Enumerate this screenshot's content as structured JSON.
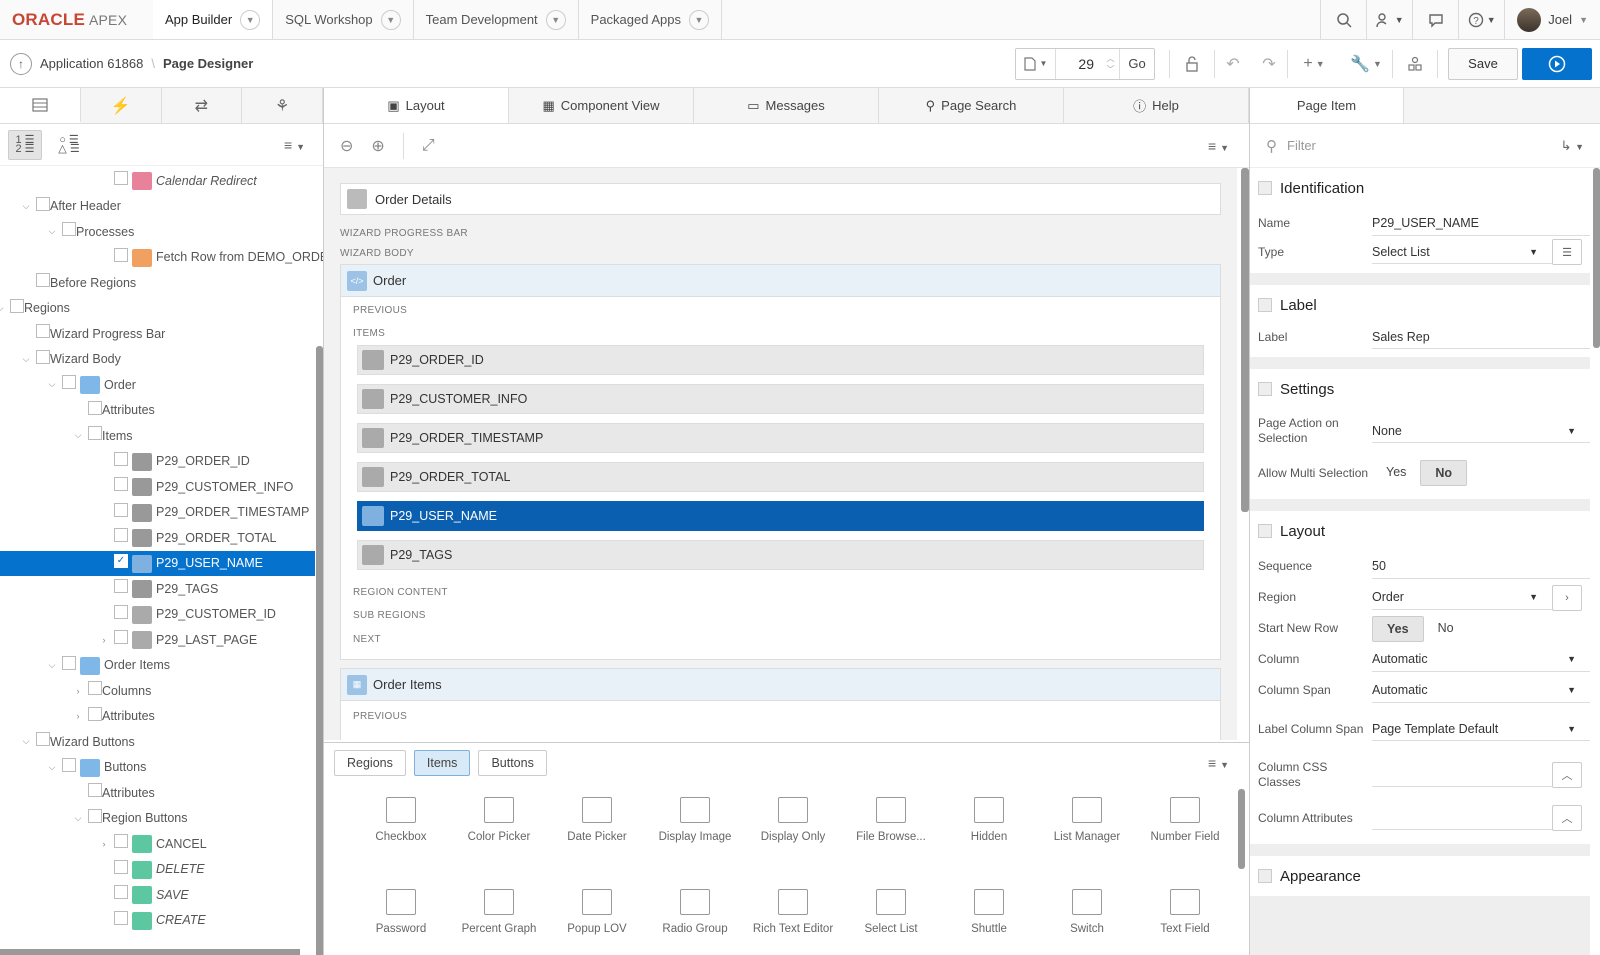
{
  "brand": {
    "oracle": "ORACLE",
    "apex": "APEX"
  },
  "nav": {
    "tabs": [
      "App Builder",
      "SQL Workshop",
      "Team Development",
      "Packaged Apps"
    ],
    "user": "Joel"
  },
  "toolbar": {
    "app": "Application 61868",
    "page": "Page Designer",
    "page_number": "29",
    "go": "Go",
    "save": "Save"
  },
  "tree": [
    {
      "label": "Calendar Redirect",
      "level": 4,
      "toggle": "",
      "icon": "redirect",
      "italic": true
    },
    {
      "label": "After Header",
      "level": 1,
      "toggle": "open",
      "icon": ""
    },
    {
      "label": "Processes",
      "level": 2,
      "toggle": "open",
      "icon": ""
    },
    {
      "label": "Fetch Row from DEMO_ORDERS",
      "level": 4,
      "toggle": "",
      "icon": "process"
    },
    {
      "label": "Before Regions",
      "level": 1,
      "toggle": "",
      "icon": ""
    },
    {
      "label": "Regions",
      "level": 0,
      "toggle": "open",
      "icon": ""
    },
    {
      "label": "Wizard Progress Bar",
      "level": 1,
      "toggle": "",
      "icon": ""
    },
    {
      "label": "Wizard Body",
      "level": 1,
      "toggle": "open",
      "icon": ""
    },
    {
      "label": "Order",
      "level": 2,
      "toggle": "open",
      "icon": "region"
    },
    {
      "label": "Attributes",
      "level": 3,
      "toggle": "",
      "icon": ""
    },
    {
      "label": "Items",
      "level": 3,
      "toggle": "open",
      "icon": ""
    },
    {
      "label": "P29_ORDER_ID",
      "level": 4,
      "toggle": "",
      "icon": "item"
    },
    {
      "label": "P29_CUSTOMER_INFO",
      "level": 4,
      "toggle": "",
      "icon": "item"
    },
    {
      "label": "P29_ORDER_TIMESTAMP",
      "level": 4,
      "toggle": "",
      "icon": "item"
    },
    {
      "label": "P29_ORDER_TOTAL",
      "level": 4,
      "toggle": "",
      "icon": "item"
    },
    {
      "label": "P29_USER_NAME",
      "level": 4,
      "toggle": "",
      "icon": "item-sel",
      "selected": true
    },
    {
      "label": "P29_TAGS",
      "level": 4,
      "toggle": "",
      "icon": "item"
    },
    {
      "label": "P29_CUSTOMER_ID",
      "level": 4,
      "toggle": "",
      "icon": "hidden"
    },
    {
      "label": "P29_LAST_PAGE",
      "level": 4,
      "toggle": "closed",
      "icon": "hidden"
    },
    {
      "label": "Order Items",
      "level": 2,
      "toggle": "open",
      "icon": "grid"
    },
    {
      "label": "Columns",
      "level": 3,
      "toggle": "closed",
      "icon": ""
    },
    {
      "label": "Attributes",
      "level": 3,
      "toggle": "closed",
      "icon": ""
    },
    {
      "label": "Wizard Buttons",
      "level": 1,
      "toggle": "open",
      "icon": ""
    },
    {
      "label": "Buttons",
      "level": 2,
      "toggle": "open",
      "icon": "region"
    },
    {
      "label": "Attributes",
      "level": 3,
      "toggle": "",
      "icon": ""
    },
    {
      "label": "Region Buttons",
      "level": 3,
      "toggle": "open",
      "icon": ""
    },
    {
      "label": "CANCEL",
      "level": 4,
      "toggle": "closed",
      "icon": "button"
    },
    {
      "label": "DELETE",
      "level": 4,
      "toggle": "",
      "icon": "button",
      "italic": true
    },
    {
      "label": "SAVE",
      "level": 4,
      "toggle": "",
      "icon": "button",
      "italic": true
    },
    {
      "label": "CREATE",
      "level": 4,
      "toggle": "",
      "icon": "button",
      "italic": true
    }
  ],
  "center": {
    "tabs": [
      "Layout",
      "Component View",
      "Messages",
      "Page Search",
      "Help"
    ],
    "order_details": "Order Details",
    "wizard_progress_bar": "WIZARD PROGRESS BAR",
    "wizard_body": "WIZARD BODY",
    "order_region": "Order",
    "previous": "PREVIOUS",
    "items_label": "ITEMS",
    "items": [
      "P29_ORDER_ID",
      "P29_CUSTOMER_INFO",
      "P29_ORDER_TIMESTAMP",
      "P29_ORDER_TOTAL",
      "P29_USER_NAME",
      "P29_TAGS"
    ],
    "region_content": "REGION CONTENT",
    "sub_regions": "SUB REGIONS",
    "next": "NEXT",
    "order_items_region": "Order Items",
    "previous2": "PREVIOUS"
  },
  "gallery": {
    "tabs": [
      "Regions",
      "Items",
      "Buttons"
    ],
    "items": [
      "Checkbox",
      "Color Picker",
      "Date Picker",
      "Display Image",
      "Display Only",
      "File Browse...",
      "Hidden",
      "List Manager",
      "Number Field",
      "Password",
      "Percent Graph",
      "Popup LOV",
      "Radio Group",
      "Rich Text Editor",
      "Select List",
      "Shuttle",
      "Switch",
      "Text Field"
    ]
  },
  "props": {
    "tab": "Page Item",
    "filter_placeholder": "Filter",
    "identification": {
      "title": "Identification",
      "name_label": "Name",
      "name": "P29_USER_NAME",
      "type_label": "Type",
      "type": "Select List"
    },
    "label": {
      "title": "Label",
      "label_label": "Label",
      "label": "Sales Rep"
    },
    "settings": {
      "title": "Settings",
      "action_label": "Page Action on Selection",
      "action": "None",
      "multi_label": "Allow Multi Selection",
      "yes": "Yes",
      "no": "No"
    },
    "layout": {
      "title": "Layout",
      "sequence_label": "Sequence",
      "sequence": "50",
      "region_label": "Region",
      "region": "Order",
      "newrow_label": "Start New Row",
      "yes": "Yes",
      "no": "No",
      "column_label": "Column",
      "column": "Automatic",
      "colspan_label": "Column Span",
      "colspan": "Automatic",
      "labelspan_label": "Label Column Span",
      "labelspan": "Page Template Default",
      "css_label": "Column CSS Classes",
      "attrs_label": "Column Attributes"
    },
    "appearance": {
      "title": "Appearance"
    }
  },
  "colors": {
    "accent": "#0572ce",
    "selected": "#0b5fb0",
    "brand": "#c74634"
  }
}
